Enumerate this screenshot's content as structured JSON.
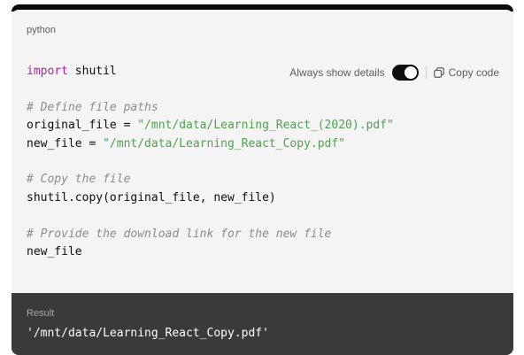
{
  "code_block": {
    "language": "python",
    "lines": [
      {
        "parts": [
          {
            "t": "kw",
            "v": "import"
          },
          {
            "t": "pl",
            "v": " shutil"
          }
        ]
      },
      {
        "parts": []
      },
      {
        "parts": [
          {
            "t": "cm",
            "v": "# Define file paths"
          }
        ]
      },
      {
        "parts": [
          {
            "t": "pl",
            "v": "original_file = "
          },
          {
            "t": "str",
            "v": "\"/mnt/data/Learning_React_(2020).pdf\""
          }
        ]
      },
      {
        "parts": [
          {
            "t": "pl",
            "v": "new_file = "
          },
          {
            "t": "str",
            "v": "\"/mnt/data/Learning_React_Copy.pdf\""
          }
        ]
      },
      {
        "parts": []
      },
      {
        "parts": [
          {
            "t": "cm",
            "v": "# Copy the file"
          }
        ]
      },
      {
        "parts": [
          {
            "t": "pl",
            "v": "shutil.copy(original_file, new_file)"
          }
        ]
      },
      {
        "parts": []
      },
      {
        "parts": [
          {
            "t": "cm",
            "v": "# Provide the download link for the new file"
          }
        ]
      },
      {
        "parts": [
          {
            "t": "pl",
            "v": "new_file"
          }
        ]
      }
    ]
  },
  "controls": {
    "toggle_label": "Always show details",
    "toggle_on": true,
    "copy_label": "Copy code",
    "copy_icon": "copy-icon"
  },
  "result": {
    "label": "Result",
    "value": "'/mnt/data/Learning_React_Copy.pdf'"
  },
  "colors": {
    "keyword": "#a626a4",
    "string": "#50a14f",
    "comment": "#8c8c8c",
    "result_bg": "#3a3a3a",
    "code_bg": "#f4f4f4"
  }
}
